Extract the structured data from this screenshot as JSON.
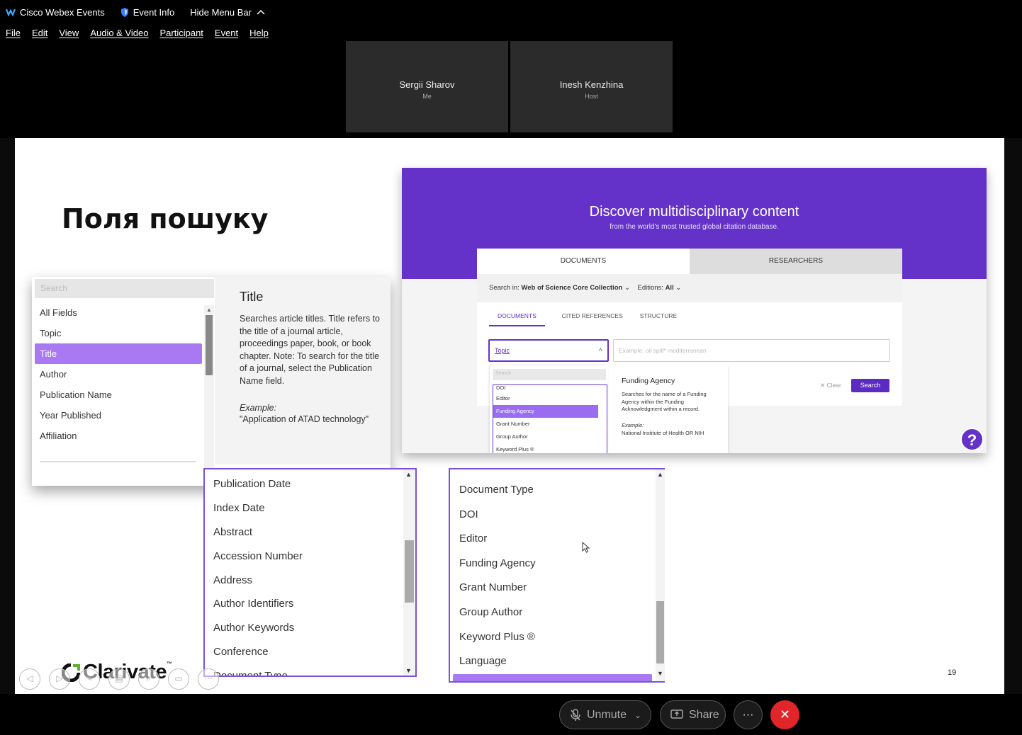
{
  "topbar": {
    "app_name": "Cisco Webex Events",
    "event_info": "Event Info",
    "hide_menu": "Hide Menu Bar"
  },
  "menu": [
    "File",
    "Edit",
    "View",
    "Audio & Video",
    "Participant",
    "Event",
    "Help"
  ],
  "participants": [
    {
      "name": "Sergii Sharov",
      "role": "Me"
    },
    {
      "name": "Inesh Kenzhina",
      "role": "Host"
    }
  ],
  "slide": {
    "title": "Поля пошуку",
    "page_number": "19",
    "logo": "Clarivate",
    "logo_tm": "™",
    "left_panel": {
      "search_placeholder": "Search",
      "options": [
        "All Fields",
        "Topic",
        "Title",
        "Author",
        "Publication Name",
        "Year Published",
        "Affiliation"
      ],
      "selected": "Title",
      "desc_title": "Title",
      "desc_text": "Searches article titles. Title refers to the title of a journal article, proceedings paper, book, or book chapter. Note: To search for the title of a journal, select the Publication Name field.",
      "example_label": "Example:",
      "example_value": "\"Application of ATAD technology\""
    },
    "wos": {
      "banner_title": "Discover multidisciplinary content",
      "banner_sub": "from the world's most trusted global citation database.",
      "tab_documents": "DOCUMENTS",
      "tab_researchers": "RESEARCHERS",
      "search_in_label": "Search in:",
      "search_in_value": "Web of Science Core Collection",
      "editions_label": "Editions:",
      "editions_value": "All",
      "subtabs": [
        "DOCUMENTS",
        "CITED REFERENCES",
        "STRUCTURE"
      ],
      "field_value": "Topic",
      "input_placeholder": "Example: oil spill* mediterranean",
      "clear": "Clear",
      "search": "Search",
      "dd_search": "Search",
      "dd_options": [
        "DOI",
        "Editor",
        "Funding Agency",
        "Grant Number",
        "Group Author",
        "Keyword Plus ®"
      ],
      "dd_selected": "Funding Agency",
      "fpanel_title": "Funding Agency",
      "fpanel_text": "Searches for the name of a Funding Agency within the Funding Acknowledgment within a record.",
      "fpanel_example_label": "Example:",
      "fpanel_example": "National Institute of Health OR NIH",
      "help": "?"
    },
    "middle_list": [
      "Publication Date",
      "Index Date",
      "Abstract",
      "Accession Number",
      "Address",
      "Author Identifiers",
      "Author Keywords",
      "Conference",
      "Document Type"
    ],
    "right_list": [
      "Document Type",
      "DOI",
      "Editor",
      "Funding Agency",
      "Grant Number",
      "Group Author",
      "Keyword Plus ®",
      "Language"
    ]
  },
  "bottom": {
    "unmute": "Unmute",
    "share": "Share",
    "more": "···"
  },
  "colors": {
    "accent": "#6532c9",
    "selected": "#a879f2",
    "leave": "#e0252b"
  }
}
